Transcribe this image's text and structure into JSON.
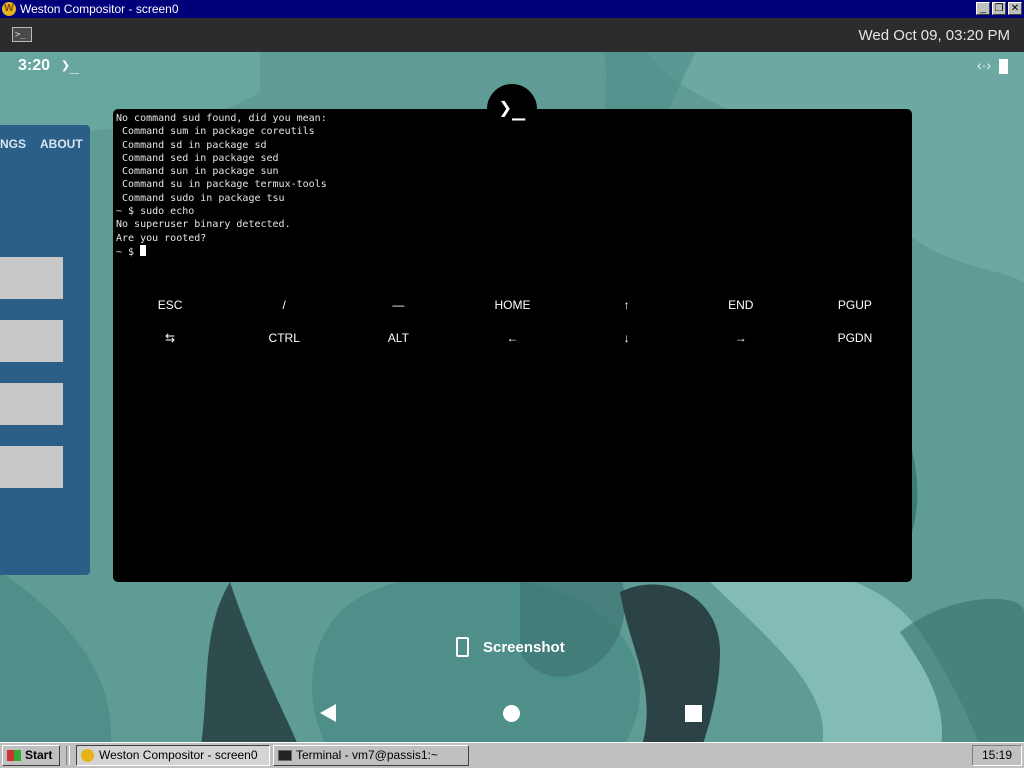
{
  "window": {
    "title": "Weston Compositor - screen0",
    "buttons": [
      "_",
      "❐",
      "✕"
    ]
  },
  "panel": {
    "clock": "Wed Oct 09, 03:20 PM",
    "launcher_icon": "terminal-icon"
  },
  "status_bar": {
    "time": "3:20",
    "notification": "❯_",
    "right_icons": [
      "data-transfer-icon",
      "battery-icon"
    ],
    "right_glyph": "‹·›"
  },
  "left_app": {
    "tabs": [
      "NGS",
      "ABOUT"
    ]
  },
  "terminal": {
    "icon_label": "❯_",
    "output": "No command sud found, did you mean:\n Command sum in package coreutils\n Command sd in package sd\n Command sed in package sed\n Command sun in package sun\n Command su in package termux-tools\n Command sudo in package tsu\n~ $ sudo echo\nNo superuser binary detected.\nAre you rooted?\n~ $ ",
    "extra_keys_row1": [
      "ESC",
      "/",
      "—",
      "HOME",
      "↑",
      "END",
      "PGUP"
    ],
    "extra_keys_row2": [
      "⇆",
      "CTRL",
      "ALT",
      "←",
      "↓",
      "→",
      "PGDN"
    ]
  },
  "toast": {
    "label": "Screenshot"
  },
  "taskbar": {
    "start": "Start",
    "tasks": [
      "Weston Compositor - screen0",
      "Terminal - vm7@passis1:~"
    ],
    "clock": "15:19"
  },
  "colors": {
    "title_bar": "#00007b",
    "wallpaper": "#5f9c96",
    "left_card": "#2c5f87",
    "taskbar": "#c0c0c0"
  }
}
